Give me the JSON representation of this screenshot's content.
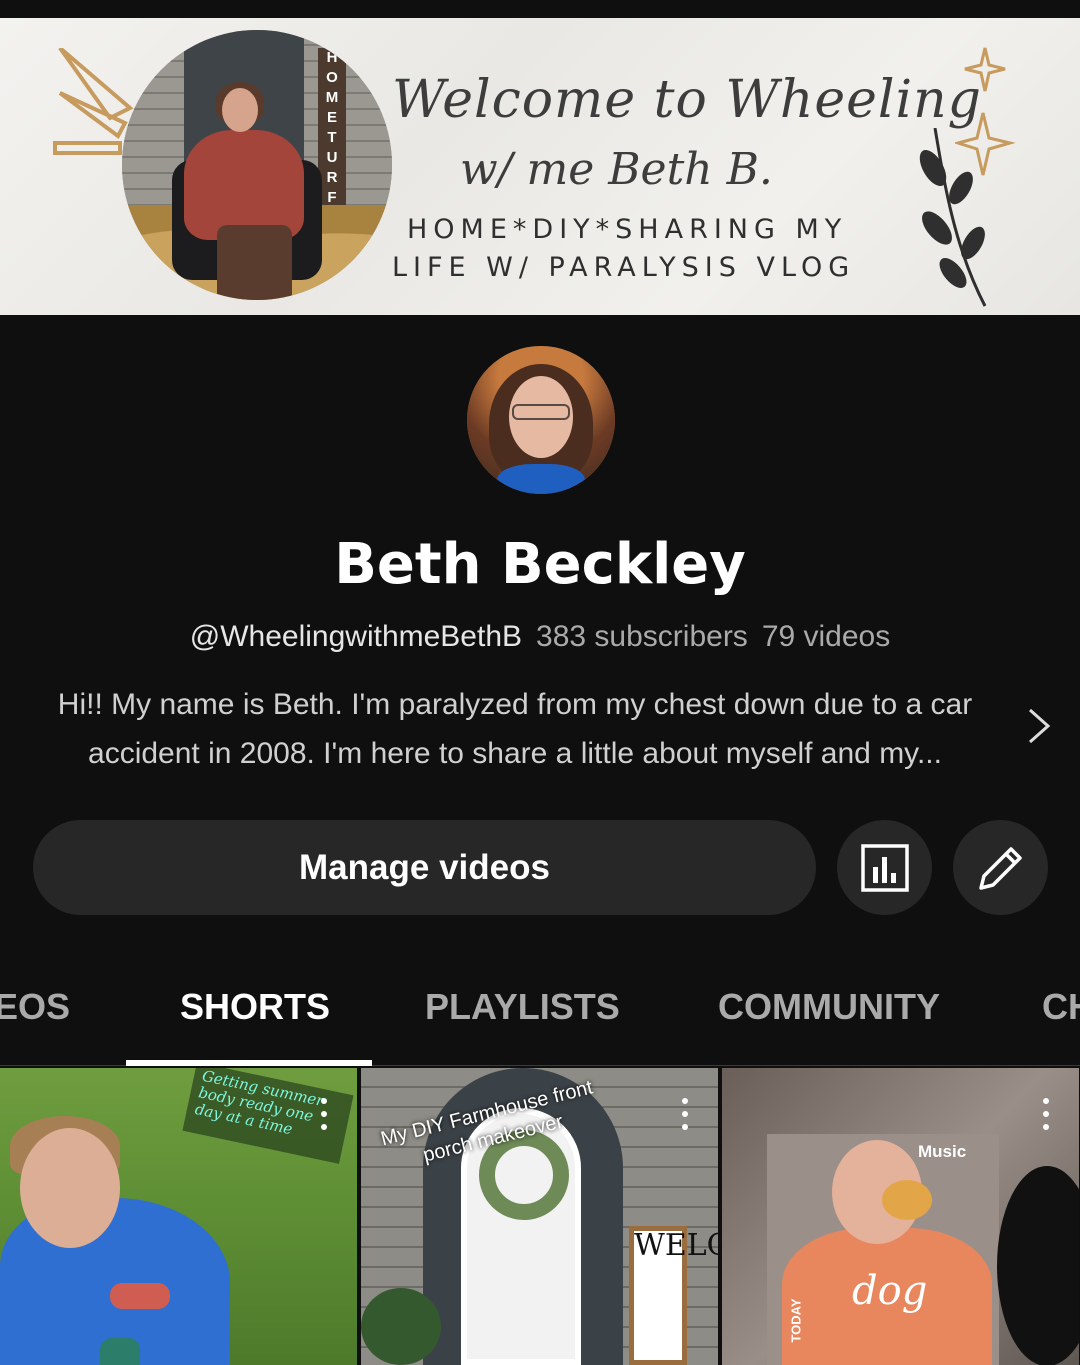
{
  "banner": {
    "script_line1": "Welcome to Wheeling",
    "script_line2": "w/ me Beth B.",
    "caps_line1": "HOME*DIY*SHARING MY",
    "caps_line2": "LIFE W/ PARALYSIS VLOG",
    "sign_letters": [
      "H",
      "O",
      "M",
      "E",
      "T",
      "U",
      "R",
      "F"
    ]
  },
  "channel": {
    "name": "Beth Beckley",
    "handle": "@WheelingwithmeBethB",
    "subscribers": "383 subscribers",
    "videos": "79 videos",
    "description": "Hi!! My name is Beth. I'm paralyzed from my chest down due to a car accident in 2008. I'm here to share a little about myself and my..."
  },
  "actions": {
    "manage_label": "Manage videos",
    "analytics_icon": "analytics-icon",
    "edit_icon": "pencil-icon"
  },
  "tabs": [
    {
      "label": "EOS",
      "active": false
    },
    {
      "label": "SHORTS",
      "active": true
    },
    {
      "label": "PLAYLISTS",
      "active": false
    },
    {
      "label": "COMMUNITY",
      "active": false
    },
    {
      "label": "CH",
      "active": false
    }
  ],
  "shorts": [
    {
      "overlay_text": "Getting summer body ready one day at a time"
    },
    {
      "overlay_text": "My DIY Farmhouse front porch makeover",
      "sign_letters": "WELC"
    },
    {
      "music_label": "Music",
      "side_text": "TODAY",
      "shirt_text": "dog"
    }
  ],
  "colors": {
    "background": "#0f0f0f",
    "button_bg": "#272727",
    "text_primary": "#f1f1f1",
    "text_secondary": "#aaaaaa"
  }
}
